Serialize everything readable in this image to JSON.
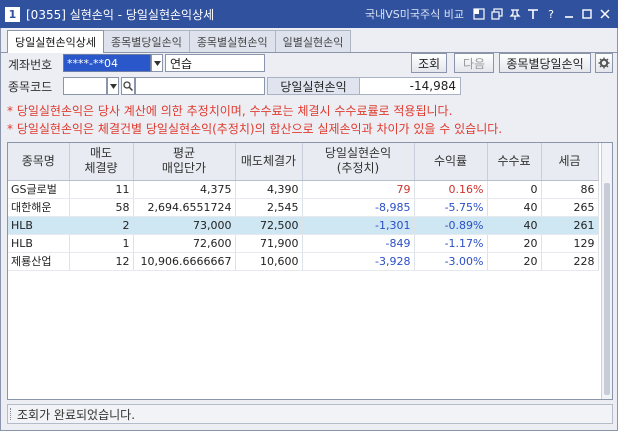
{
  "window": {
    "number": "1",
    "title": "[0355] 실현손익 - 당일실현손익상세",
    "link": "국내VS미국주식 비교",
    "help": "?"
  },
  "tabs": [
    {
      "label": "당일실현손익상세",
      "active": true
    },
    {
      "label": "종목별당일손익",
      "active": false
    },
    {
      "label": "종목별실현손익",
      "active": false
    },
    {
      "label": "일별실현손익",
      "active": false
    }
  ],
  "form": {
    "account_label": "계좌번호",
    "account_value": "****-**04",
    "account_name": "연습",
    "stock_code_label": "종목코드",
    "stock_code_value": "",
    "stock_name_value": "",
    "query_button": "조회",
    "next_button": "다음",
    "by_stock_button": "종목별당일손익",
    "summary_label": "당일실현손익",
    "summary_value": "-14,984"
  },
  "notes": [
    "* 당일실현손익은 당사 계산에 의한 추정치이며, 수수료는 체결시 수수료률로 적용됩니다.",
    "* 당일실현손익은 체결건별 당일실현손익(추정치)의 합산으로 실제손익과 차이가 있을 수 있습니다."
  ],
  "table": {
    "headers": [
      {
        "line1": "종목명",
        "line2": ""
      },
      {
        "line1": "매도",
        "line2": "체결량"
      },
      {
        "line1": "평균",
        "line2": "매입단가"
      },
      {
        "line1": "매도체결가",
        "line2": ""
      },
      {
        "line1": "당일실현손익",
        "line2": "(추정치)"
      },
      {
        "line1": "수익률",
        "line2": ""
      },
      {
        "line1": "수수료",
        "line2": ""
      },
      {
        "line1": "세금",
        "line2": ""
      }
    ],
    "rows": [
      {
        "name": "GS글로벌",
        "qty": "11",
        "avg_price": "4,375",
        "sell_price": "4,390",
        "pnl": "79",
        "rate": "0.16%",
        "fee": "0",
        "tax": "86",
        "sign": "pos",
        "selected": false
      },
      {
        "name": "대한해운",
        "qty": "58",
        "avg_price": "2,694.6551724",
        "sell_price": "2,545",
        "pnl": "-8,985",
        "rate": "-5.75%",
        "fee": "40",
        "tax": "265",
        "sign": "neg",
        "selected": false
      },
      {
        "name": "HLB",
        "qty": "2",
        "avg_price": "73,000",
        "sell_price": "72,500",
        "pnl": "-1,301",
        "rate": "-0.89%",
        "fee": "40",
        "tax": "261",
        "sign": "neg",
        "selected": true
      },
      {
        "name": "HLB",
        "qty": "1",
        "avg_price": "72,600",
        "sell_price": "71,900",
        "pnl": "-849",
        "rate": "-1.17%",
        "fee": "20",
        "tax": "129",
        "sign": "neg",
        "selected": false
      },
      {
        "name": "제룡산업",
        "qty": "12",
        "avg_price": "10,906.6666667",
        "sell_price": "10,600",
        "pnl": "-3,928",
        "rate": "-3.00%",
        "fee": "20",
        "tax": "228",
        "sign": "neg",
        "selected": false
      }
    ]
  },
  "status": {
    "message": "조회가 완료되었습니다."
  },
  "colors": {
    "titlebar": "#30519e",
    "positive": "#d0312d",
    "negative": "#2a4fc6",
    "selected_row": "#cfe6f3",
    "note_text": "#e03a2f"
  }
}
